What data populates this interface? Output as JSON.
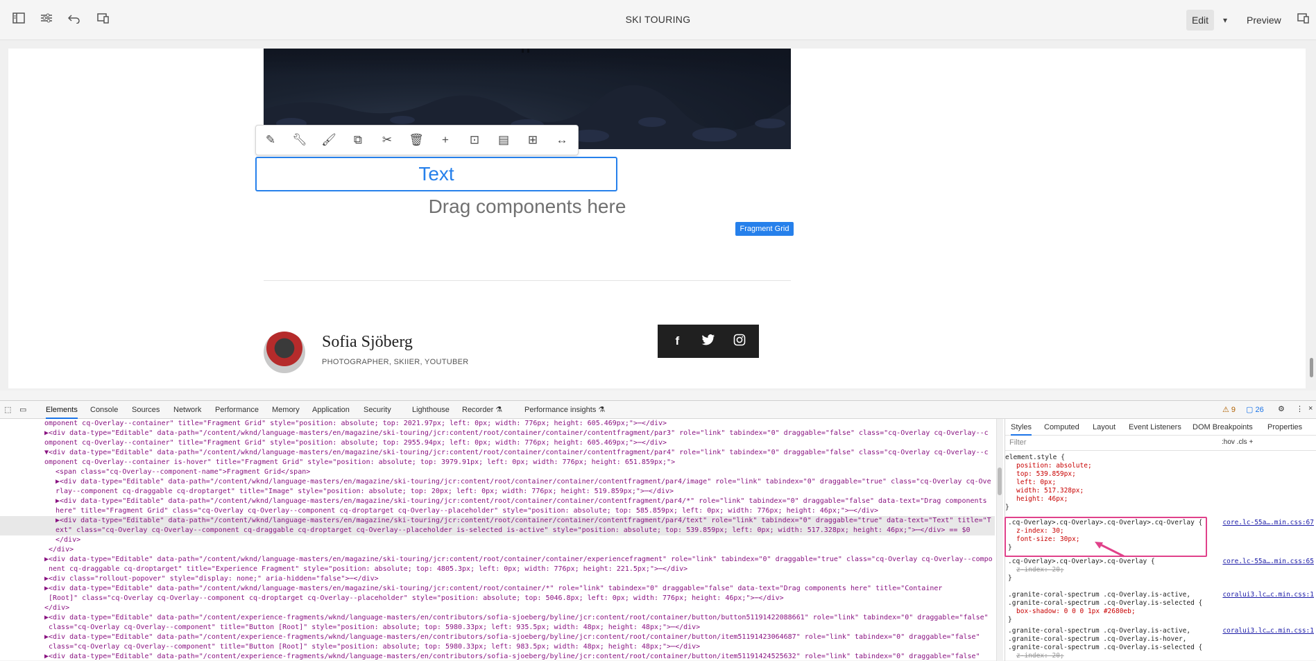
{
  "topbar": {
    "title": "SKI TOURING",
    "edit_label": "Edit",
    "preview_label": "Preview",
    "icons": [
      "side-panel-icon",
      "properties-icon",
      "undo-icon",
      "emulator-icon"
    ]
  },
  "canvas": {
    "text_component_label": "Text",
    "drag_placeholder": "Drag components here",
    "fragment_badge": "Fragment Grid",
    "byline": {
      "name": "Sofia Sjöberg",
      "role": "PHOTOGRAPHER, SKIIER, YOUTUBER"
    },
    "social": [
      "f",
      "t",
      "ig"
    ]
  },
  "devtools": {
    "tabs": [
      "Elements",
      "Console",
      "Sources",
      "Network",
      "Performance",
      "Memory",
      "Application",
      "Security",
      "Lighthouse",
      "Recorder ⚗",
      "Performance insights ⚗"
    ],
    "active_tab": "Elements",
    "warnings": "⚠ 9",
    "messages": "▢ 26",
    "dom_lines": [
      "omponent cq-Overlay--container\" title=\"Fragment Grid\" style=\"position: absolute; top: 2021.97px; left: 0px; width: 776px; height: 605.469px;\">⋯</div>",
      "▶<div data-type=\"Editable\" data-path=\"/content/wknd/language-masters/en/magazine/ski-touring/jcr:content/root/container/container/contentfragment/par3\" role=\"link\" tabindex=\"0\" draggable=\"false\" class=\"cq-Overlay cq-Overlay--c",
      "omponent cq-Overlay--container\" title=\"Fragment Grid\" style=\"position: absolute; top: 2955.94px; left: 0px; width: 776px; height: 605.469px;\">⋯</div>",
      "▼<div data-type=\"Editable\" data-path=\"/content/wknd/language-masters/en/magazine/ski-touring/jcr:content/root/container/container/contentfragment/par4\" role=\"link\" tabindex=\"0\" draggable=\"false\" class=\"cq-Overlay cq-Overlay--c",
      "omponent cq-Overlay--container is-hover\" title=\"Fragment Grid\" style=\"position: absolute; top: 3979.91px; left: 0px; width: 776px; height: 651.859px;\">",
      "  <span class=\"cq-Overlay--component-name\">Fragment Grid</span>",
      "  ▶<div data-type=\"Editable\" data-path=\"/content/wknd/language-masters/en/magazine/ski-touring/jcr:content/root/container/container/contentfragment/par4/image\" role=\"link\" tabindex=\"0\" draggable=\"true\" class=\"cq-Overlay cq-Ove",
      "  rlay--component cq-draggable cq-droptarget\" title=\"Image\" style=\"position: absolute; top: 20px; left: 0px; width: 776px; height: 519.859px;\">⋯</div>",
      "  ▶<div data-type=\"Editable\" data-path=\"/content/wknd/language-masters/en/magazine/ski-touring/jcr:content/root/container/container/contentfragment/par4/*\" role=\"link\" tabindex=\"0\" draggable=\"false\" data-text=\"Drag components",
      "  here\" title=\"Fragment Grid\" class=\"cq-Overlay cq-Overlay--component cq-droptarget cq-Overlay--placeholder\" style=\"position: absolute; top: 585.859px; left: 0px; width: 776px; height: 46px;\">⋯</div>",
      "  ▶<div data-type=\"Editable\" data-path=\"/content/wknd/language-masters/en/magazine/ski-touring/jcr:content/root/container/container/contentfragment/par4/text\" role=\"link\" tabindex=\"0\" draggable=\"true\" data-text=\"Text\" title=\"T",
      "  ext\" class=\"cq-Overlay cq-Overlay--component cq-draggable cq-droptarget cq-Overlay--placeholder is-selected is-active\" style=\"position: absolute; top: 539.859px; left: 0px; width: 517.328px; height: 46px;\">⋯</div> == $0",
      "  </div>",
      " </div>",
      "▶<div data-type=\"Editable\" data-path=\"/content/wknd/language-masters/en/magazine/ski-touring/jcr:content/root/container/container/experiencefragment\" role=\"link\" tabindex=\"0\" draggable=\"true\" class=\"cq-Overlay cq-Overlay--compo",
      " nent cq-draggable cq-droptarget\" title=\"Experience Fragment\" style=\"position: absolute; top: 4805.3px; left: 0px; width: 776px; height: 221.5px;\">⋯</div>",
      "▶<div class=\"rollout-popover\" style=\"display: none;\" aria-hidden=\"false\">⋯</div>",
      "▶<div data-type=\"Editable\" data-path=\"/content/wknd/language-masters/en/magazine/ski-touring/jcr:content/root/container/*\" role=\"link\" tabindex=\"0\" draggable=\"false\" data-text=\"Drag components here\" title=\"Container",
      " [Root]\" class=\"cq-Overlay cq-Overlay--component cq-droptarget cq-Overlay--placeholder\" style=\"position: absolute; top: 5046.8px; left: 0px; width: 776px; height: 46px;\">⋯</div>",
      "</div>",
      "▶<div data-type=\"Editable\" data-path=\"/content/experience-fragments/wknd/language-masters/en/contributors/sofia-sjoeberg/byline/jcr:content/root/container/button/button51191422088661\" role=\"link\" tabindex=\"0\" draggable=\"false\"",
      " class=\"cq-Overlay cq-Overlay--component\" title=\"Button [Root]\" style=\"position: absolute; top: 5980.33px; left: 935.5px; width: 48px; height: 48px;\">⋯</div>",
      "▶<div data-type=\"Editable\" data-path=\"/content/experience-fragments/wknd/language-masters/en/contributors/sofia-sjoeberg/byline/jcr:content/root/container/button/item51191423064687\" role=\"link\" tabindex=\"0\" draggable=\"false\"",
      " class=\"cq-Overlay cq-Overlay--component\" title=\"Button [Root]\" style=\"position: absolute; top: 5980.33px; left: 983.5px; width: 48px; height: 48px;\">⋯</div>",
      "▶<div data-type=\"Editable\" data-path=\"/content/experience-fragments/wknd/language-masters/en/contributors/sofia-sjoeberg/byline/jcr:content/root/container/button/item51191424525632\" role=\"link\" tabindex=\"0\" draggable=\"false\""
    ],
    "styles_tabs": [
      "Styles",
      "Computed",
      "Layout",
      "Event Listeners",
      "DOM Breakpoints",
      "Properties"
    ],
    "filter_placeholder": "Filter",
    "filter_tools": ":hov  .cls  +",
    "element_style": {
      "selector": "element.style {",
      "props": [
        "position: absolute;",
        "top: 539.859px;",
        "left: 0px;",
        "width: 517.328px;",
        "height: 46px;"
      ]
    },
    "rule1": {
      "selector": ".cq-Overlay>.cq-Overlay>.cq-Overlay>.cq-Overlay {",
      "src": "core.lc-55a….min.css:67",
      "props": [
        "z-index: 30;",
        "font-size: 30px;"
      ]
    },
    "rule2": {
      "selector": ".cq-Overlay>.cq-Overlay>.cq-Overlay {",
      "src": "core.lc-55a….min.css:65",
      "props": [
        "z-index: 20;"
      ]
    },
    "rule3": {
      "selector": ".granite-coral-spectrum .cq-Overlay.is-active,\n.granite-coral-spectrum .cq-Overlay.is-selected {",
      "src": "coralui3.lc…c.min.css:1",
      "props": [
        "box-shadow: 0 0 0 1px #2680eb;"
      ]
    },
    "rule4": {
      "selector": ".granite-coral-spectrum .cq-Overlay.is-active,\n.granite-coral-spectrum .cq-Overlay.is-hover,\n.granite-coral-spectrum .cq-Overlay.is-selected {",
      "src": "coralui3.lc…c.min.css:1",
      "props": [
        "z-index: 20;"
      ]
    },
    "close_brace": "}"
  }
}
